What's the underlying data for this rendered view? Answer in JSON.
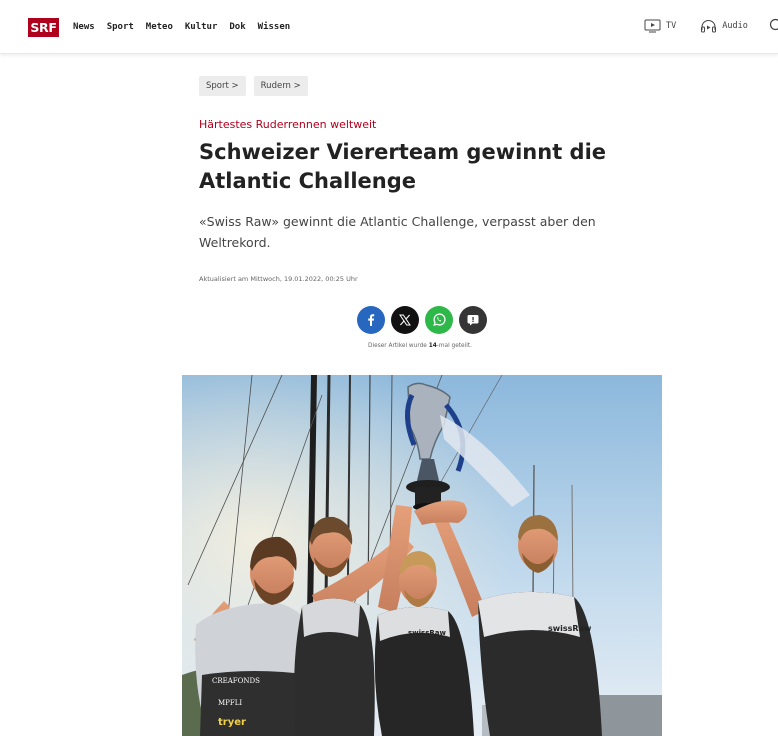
{
  "header": {
    "logo": "SRF",
    "nav": [
      "News",
      "Sport",
      "Meteo",
      "Kultur",
      "Dok",
      "Wissen"
    ],
    "tv_label": "TV",
    "audio_label": "Audio"
  },
  "breadcrumb": [
    "Sport >",
    "Rudern >"
  ],
  "article": {
    "kicker": "Härtestes Ruderrennen weltweit",
    "headline": "Schweizer Viererteam gewinnt die Atlantic Challenge",
    "lead": "«Swiss Raw» gewinnt die Atlantic Challenge, verpasst aber den Weltrekord.",
    "dateline": "Aktualisiert am Mittwoch, 19.01.2022, 00:25 Uhr"
  },
  "share": {
    "prefix": "Dieser Artikel wurde ",
    "count": "14",
    "suffix": "-mal geteilt.",
    "buttons": [
      "facebook-icon",
      "x-icon",
      "whatsapp-icon",
      "comment-icon"
    ]
  },
  "hero_image": {
    "shirt_texts": [
      "swissRaw",
      "swissRaw",
      "CREAFONDS",
      "MPFLI",
      "tryer"
    ]
  },
  "colors": {
    "brand": "#af001d",
    "facebook": "#2767c0",
    "whatsapp": "#2fb84a"
  }
}
